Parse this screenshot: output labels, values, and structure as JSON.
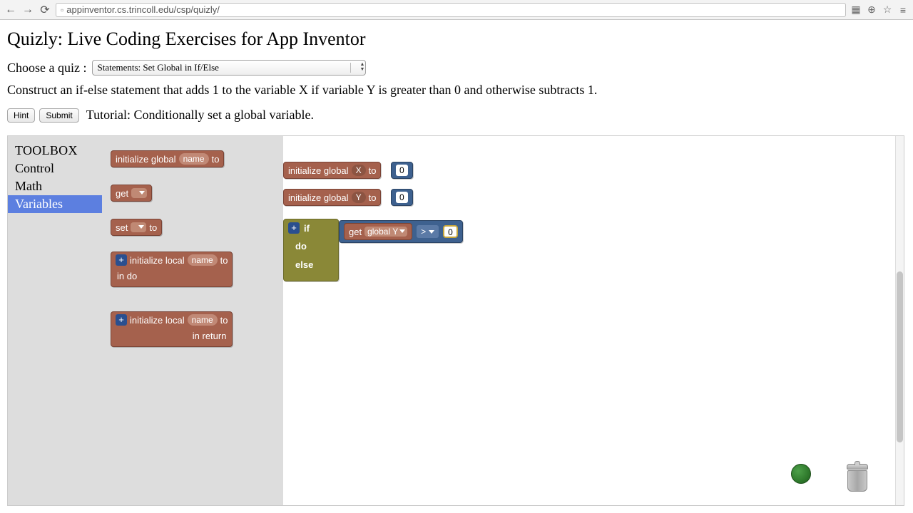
{
  "url": "appinventor.cs.trincoll.edu/csp/quizly/",
  "page_title": "Quizly: Live Coding Exercises for App Inventor",
  "choose_label": "Choose a quiz :",
  "selected_quiz": "Statements: Set Global in If/Else",
  "instruction": "Construct an if-else statement that adds 1 to the variable X if variable Y is greater than 0 and otherwise subtracts 1.",
  "buttons": {
    "hint": "Hint",
    "submit": "Submit"
  },
  "tutorial_text": "Tutorial: Conditionally set a global variable.",
  "toolbox_title": "TOOLBOX",
  "categories": [
    "Control",
    "Math",
    "Variables"
  ],
  "selected_category_index": 2,
  "flyout_blocks": {
    "init_global": {
      "prefix": "initialize global",
      "name_tag": "name",
      "suffix": "to"
    },
    "get": {
      "label": "get"
    },
    "set": {
      "prefix": "set",
      "suffix": "to"
    },
    "init_local_do": {
      "prefix": "initialize local",
      "name_tag": "name",
      "mid": "to",
      "suffix": "in do"
    },
    "init_local_return": {
      "prefix": "initialize local",
      "name_tag": "name",
      "mid": "to",
      "suffix": "in return"
    }
  },
  "canvas_blocks": {
    "init_x": {
      "prefix": "initialize global",
      "var_tag": "X",
      "mid": "to",
      "value": "0"
    },
    "init_y": {
      "prefix": "initialize global",
      "var_tag": "Y",
      "mid": "to",
      "value": "0"
    },
    "ifelse": {
      "if_label": "if",
      "do_label": "do",
      "else_label": "else",
      "cond": {
        "get_label": "get",
        "var_dd": "global Y",
        "op": ">",
        "rhs": "0"
      }
    }
  }
}
